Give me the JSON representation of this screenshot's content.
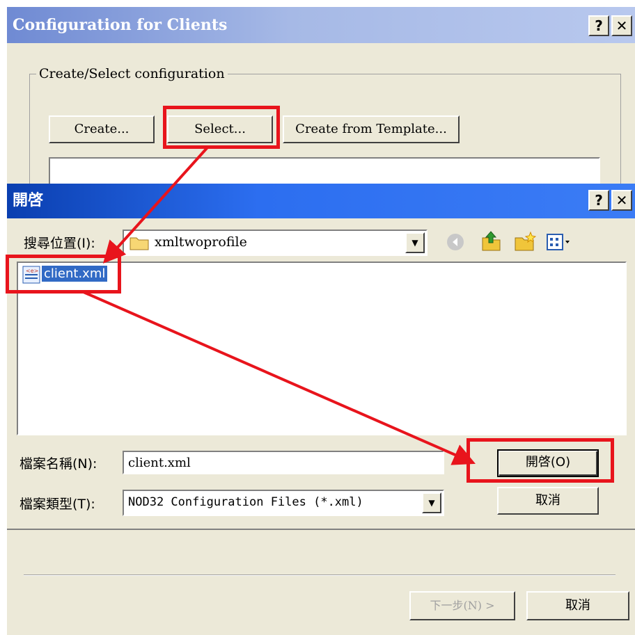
{
  "bg_dialog": {
    "title": "Configuration for Clients",
    "help_label": "?",
    "close_label": "✕",
    "group_label": "Create/Select configuration",
    "create_label": "Create...",
    "select_label": "Select...",
    "template_label": "Create from Template...",
    "back_label": "下一步(N) >",
    "cancel_label": "取消"
  },
  "open_dialog": {
    "title": "開啓",
    "help_label": "?",
    "close_label": "✕",
    "lookin_label": "搜尋位置(I):",
    "lookin_value": "xmltwoprofile",
    "files": [
      "client.xml"
    ],
    "filename_label": "檔案名稱(N):",
    "filename_value": "client.xml",
    "filetype_label": "檔案類型(T):",
    "filetype_value": "NOD32 Configuration Files (*.xml)",
    "open_label": "開啓(O)",
    "cancel_label": "取消"
  },
  "colors": {
    "highlight": "#e8141c",
    "titlebar": "#0a3fb0",
    "face": "#ece9d8"
  }
}
